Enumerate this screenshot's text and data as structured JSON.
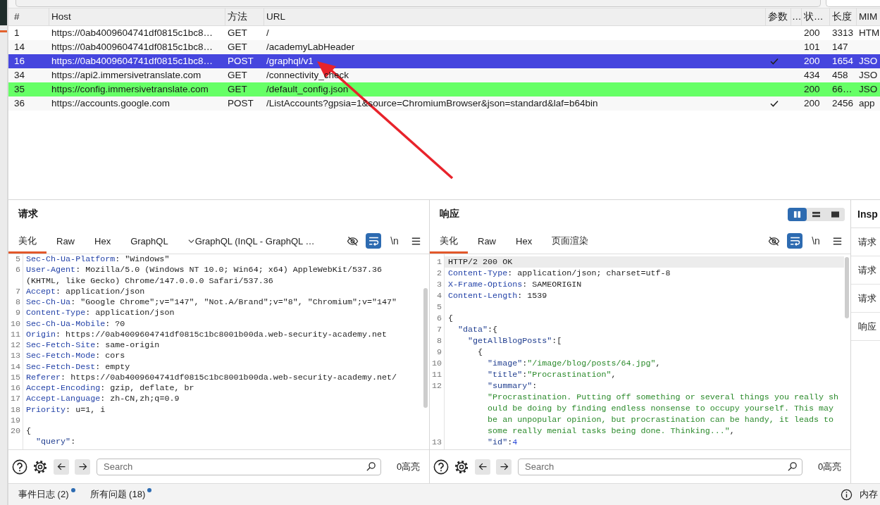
{
  "table": {
    "columns": [
      "#",
      "Host",
      "方法",
      "URL",
      "参数",
      "…",
      "状…",
      "长度",
      "MIM"
    ],
    "rows": [
      {
        "number": "1",
        "host": "https://0ab4009604741df0815c1bc8…",
        "method": "GET",
        "url": "/",
        "params": false,
        "status": "200",
        "length": "3313",
        "mime": "HTM",
        "selected": false
      },
      {
        "number": "14",
        "host": "https://0ab4009604741df0815c1bc8…",
        "method": "GET",
        "url": "/academyLabHeader",
        "params": false,
        "status": "101",
        "length": "147",
        "selected": false
      },
      {
        "number": "16",
        "host": "https://0ab4009604741df0815c1bc8…",
        "method": "POST",
        "url": "/graphql/v1",
        "params": true,
        "status": "200",
        "length": "1654",
        "mime": "JSO",
        "selected": true
      },
      {
        "number": "34",
        "host": "https://api2.immersivetranslate.com",
        "method": "GET",
        "url": "/connectivity_check",
        "params": false,
        "status": "434",
        "length": "458",
        "mime": "JSO",
        "selected": false
      },
      {
        "number": "35",
        "host": "https://config.immersivetranslate.com",
        "method": "GET",
        "url": "/default_config.json",
        "params": false,
        "status": "200",
        "length": "66…",
        "mime": "JSO",
        "selected": false,
        "color": "#66ff66"
      },
      {
        "number": "36",
        "host": "https://accounts.google.com",
        "method": "POST",
        "url": "/ListAccounts?gpsia=1&source=ChromiumBrowser&json=standard&laf=b64bin",
        "params": true,
        "status": "200",
        "length": "2456",
        "mime": "app",
        "selected": false
      }
    ]
  },
  "request": {
    "title": "请求",
    "tabs": [
      {
        "label": "美化",
        "kind": "plain",
        "selected": true
      },
      {
        "label": "Raw",
        "kind": "plain",
        "selected": false
      },
      {
        "label": "Hex",
        "kind": "plain",
        "selected": false
      },
      {
        "label": "GraphQL",
        "kind": "plain",
        "selected": false
      },
      {
        "label": "GraphQL (InQL - GraphQL …",
        "kind": "dropdown",
        "selected": false
      }
    ],
    "tools": [
      {
        "kind": "hide",
        "on": false
      },
      {
        "kind": "wrap",
        "on": true
      },
      {
        "kind": "newline",
        "label": "\\n",
        "on": false
      },
      {
        "kind": "menu"
      }
    ],
    "lines": [
      {
        "number": "5",
        "tokens": [
          {
            "kind": "name",
            "text": "Sec-Ch-Ua-Platform"
          },
          {
            "kind": "plain",
            "text": ": \"Windows\""
          }
        ]
      },
      {
        "number": "6",
        "tokens": [
          {
            "kind": "name",
            "text": "User-Agent"
          },
          {
            "kind": "plain",
            "text": ": Mozilla/5.0 (Windows NT 10.0; Win64; x64) AppleWebKit/537.36 (KHTML, like Gecko) Chrome/147.0.0.0 Safari/537.36"
          }
        ]
      },
      {
        "number": "7",
        "tokens": [
          {
            "kind": "name",
            "text": "Accept"
          },
          {
            "kind": "plain",
            "text": ": application/json"
          }
        ]
      },
      {
        "number": "8",
        "tokens": [
          {
            "kind": "name",
            "text": "Sec-Ch-Ua"
          },
          {
            "kind": "plain",
            "text": ": \"Google Chrome\";v=\"147\", \"Not.A/Brand\";v=\"8\", \"Chromium\";v=\"147\""
          }
        ]
      },
      {
        "number": "9",
        "tokens": [
          {
            "kind": "name",
            "text": "Content-Type"
          },
          {
            "kind": "plain",
            "text": ": application/json"
          }
        ]
      },
      {
        "number": "10",
        "tokens": [
          {
            "kind": "name",
            "text": "Sec-Ch-Ua-Mobile"
          },
          {
            "kind": "plain",
            "text": ": ?0"
          }
        ]
      },
      {
        "number": "11",
        "tokens": [
          {
            "kind": "name",
            "text": "Origin"
          },
          {
            "kind": "plain",
            "text": ": https://0ab4009604741df0815c1bc8001b00da.web-security-academy.net"
          }
        ]
      },
      {
        "number": "12",
        "tokens": [
          {
            "kind": "name",
            "text": "Sec-Fetch-Site"
          },
          {
            "kind": "plain",
            "text": ": same-origin"
          }
        ]
      },
      {
        "number": "13",
        "tokens": [
          {
            "kind": "name",
            "text": "Sec-Fetch-Mode"
          },
          {
            "kind": "plain",
            "text": ": cors"
          }
        ]
      },
      {
        "number": "14",
        "tokens": [
          {
            "kind": "name",
            "text": "Sec-Fetch-Dest"
          },
          {
            "kind": "plain",
            "text": ": empty"
          }
        ]
      },
      {
        "number": "15",
        "tokens": [
          {
            "kind": "name",
            "text": "Referer"
          },
          {
            "kind": "plain",
            "text": ": https://0ab4009604741df0815c1bc8001b00da.web-security-academy.net/"
          }
        ]
      },
      {
        "number": "16",
        "tokens": [
          {
            "kind": "name",
            "text": "Accept-Encoding"
          },
          {
            "kind": "plain",
            "text": ": gzip, deflate, br"
          }
        ]
      },
      {
        "number": "17",
        "tokens": [
          {
            "kind": "name",
            "text": "Accept-Language"
          },
          {
            "kind": "plain",
            "text": ": zh-CN,zh;q=0.9"
          }
        ]
      },
      {
        "number": "18",
        "tokens": [
          {
            "kind": "name",
            "text": "Priority"
          },
          {
            "kind": "plain",
            "text": ": u=1, i"
          }
        ]
      },
      {
        "number": "19"
      },
      {
        "number": "20",
        "tokens": [
          {
            "kind": "plain",
            "text": "{"
          }
        ]
      },
      {
        "tokens": [
          {
            "kind": "key",
            "text": "  \"query\""
          },
          {
            "kind": "plain",
            "text": ":"
          }
        ]
      }
    ],
    "search": {
      "placeholder": "Search"
    },
    "highlight_count": "0高亮"
  },
  "response": {
    "title": "响应",
    "layout_buttons": [
      {
        "kind": "columns",
        "selected": true
      },
      {
        "kind": "rows",
        "selected": false
      },
      {
        "kind": "single",
        "selected": false
      }
    ],
    "tabs": [
      {
        "label": "美化",
        "kind": "plain",
        "selected": true
      },
      {
        "label": "Raw",
        "kind": "plain",
        "selected": false
      },
      {
        "label": "Hex",
        "kind": "plain",
        "selected": false
      },
      {
        "label": "页面渲染",
        "kind": "plain",
        "selected": false
      }
    ],
    "tools": [
      {
        "kind": "hide",
        "on": false
      },
      {
        "kind": "wrap",
        "on": true
      },
      {
        "kind": "newline",
        "label": "\\n",
        "on": false
      },
      {
        "kind": "menu"
      }
    ],
    "lines": [
      {
        "number": "1",
        "current": true,
        "tokens": [
          {
            "kind": "plain",
            "text": "HTTP/2 200 OK"
          }
        ]
      },
      {
        "number": "2",
        "current": false,
        "tokens": [
          {
            "kind": "name",
            "text": "Content-Type"
          },
          {
            "kind": "plain",
            "text": ": application/json; charset=utf-8"
          }
        ]
      },
      {
        "number": "3",
        "current": false,
        "tokens": [
          {
            "kind": "name",
            "text": "X-Frame-Options"
          },
          {
            "kind": "plain",
            "text": ": SAMEORIGIN"
          }
        ]
      },
      {
        "number": "4",
        "current": false,
        "tokens": [
          {
            "kind": "name",
            "text": "Content-Length"
          },
          {
            "kind": "plain",
            "text": ": 1539"
          }
        ]
      },
      {
        "number": "5",
        "current": false
      },
      {
        "number": "6",
        "current": false,
        "tokens": [
          {
            "kind": "plain",
            "text": "{"
          }
        ]
      },
      {
        "number": "7",
        "current": false,
        "tokens": [
          {
            "kind": "key",
            "text": "  \"data\""
          },
          {
            "kind": "plain",
            "text": ":{"
          }
        ]
      },
      {
        "number": "8",
        "current": false,
        "tokens": [
          {
            "kind": "key",
            "text": "    \"getAllBlogPosts\""
          },
          {
            "kind": "plain",
            "text": ":["
          }
        ]
      },
      {
        "number": "9",
        "current": false,
        "tokens": [
          {
            "kind": "plain",
            "text": "      {"
          }
        ]
      },
      {
        "number": "10",
        "current": false,
        "tokens": [
          {
            "kind": "key",
            "text": "        \"image\""
          },
          {
            "kind": "plain",
            "text": ":"
          },
          {
            "kind": "string",
            "text": "\"/image/blog/posts/64.jpg\""
          },
          {
            "kind": "plain",
            "text": ","
          }
        ]
      },
      {
        "number": "11",
        "current": false,
        "tokens": [
          {
            "kind": "key",
            "text": "        \"title\""
          },
          {
            "kind": "plain",
            "text": ":"
          },
          {
            "kind": "string",
            "text": "\"Procrastination\""
          },
          {
            "kind": "plain",
            "text": ","
          }
        ]
      },
      {
        "number": "12",
        "current": false,
        "tokens": [
          {
            "kind": "key",
            "text": "        \"summary\""
          },
          {
            "kind": "plain",
            "text": ":"
          },
          {
            "kind": "break"
          },
          {
            "kind": "string",
            "text": "\"Procrastination. Putting off something or several things you really should be doing by finding endless nonsense to occupy yourself. This may be an unpopular opinion, but procrastination can be handy, it leads to some really menial tasks being done. Thinking...\""
          },
          {
            "kind": "plain",
            "text": ","
          }
        ]
      },
      {
        "number": "13",
        "current": false,
        "tokens": [
          {
            "kind": "key",
            "text": "        \"id\""
          },
          {
            "kind": "plain",
            "text": ":"
          },
          {
            "kind": "number",
            "text": "4"
          }
        ]
      }
    ],
    "search": {
      "placeholder": "Search"
    },
    "highlight_count": "0高亮"
  },
  "inspector": {
    "title": "Insp",
    "sections": [
      "请求",
      "请求",
      "请求",
      "响应"
    ]
  },
  "status_bar": {
    "tabs": [
      {
        "label": "事件日志 (2)",
        "unread": true
      },
      {
        "label": "所有问题 (18)",
        "unread": true
      }
    ],
    "memory": "内存"
  }
}
